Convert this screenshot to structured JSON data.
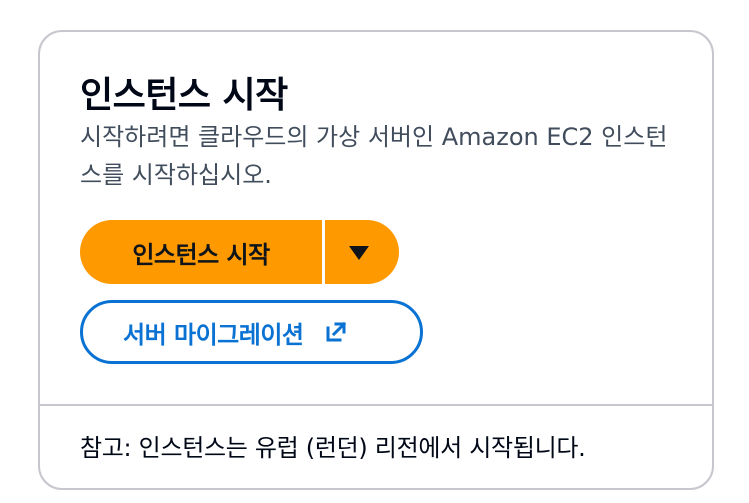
{
  "card": {
    "title": "인스턴스 시작",
    "description": "시작하려면 클라우드의 가상 서버인 Amazon EC2 인스턴스를 시작하십시오.",
    "launch_button_label": "인스턴스 시작",
    "dropdown_icon": "caret-down-icon",
    "migrate_button_label": "서버 마이그레이션",
    "external_link_icon": "external-link-icon",
    "note": "참고: 인스턴스는 유럽 (런던) 리전에서 시작됩니다."
  },
  "colors": {
    "primary": "#ff9900",
    "link": "#0972d3",
    "border": "#c6c6cd",
    "text": "#000716",
    "secondary_text": "#414d5c"
  }
}
